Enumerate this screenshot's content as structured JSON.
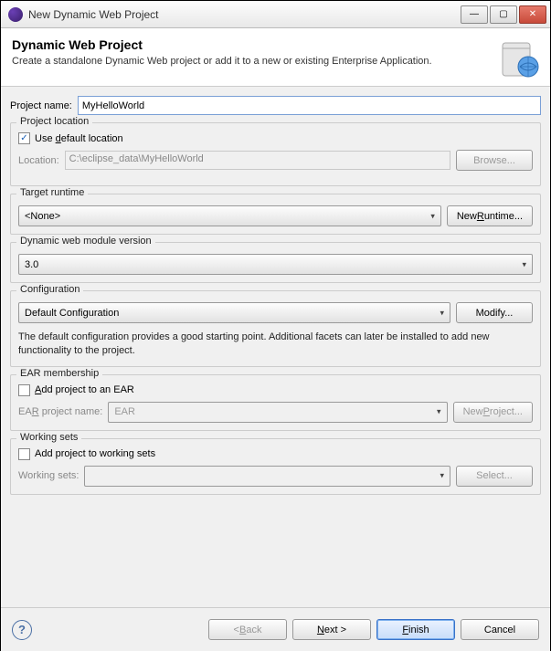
{
  "window": {
    "title": "New Dynamic Web Project"
  },
  "banner": {
    "heading": "Dynamic Web Project",
    "subtitle": "Create a standalone Dynamic Web project or add it to a new or existing Enterprise Application."
  },
  "project_name": {
    "label": "Project name:",
    "value": "MyHelloWorld"
  },
  "project_location": {
    "group_title": "Project location",
    "use_default_checked": true,
    "use_default_label_pre": "Use ",
    "use_default_label_u": "d",
    "use_default_label_post": "efault location",
    "location_label": "Location:",
    "location_value": "C:\\eclipse_data\\MyHelloWorld",
    "browse_label": "Browse..."
  },
  "target_runtime": {
    "group_title": "Target runtime",
    "value": "<None>",
    "new_runtime_pre": "New ",
    "new_runtime_u": "R",
    "new_runtime_post": "untime..."
  },
  "module_version": {
    "group_title": "Dynamic web module version",
    "value": "3.0"
  },
  "configuration": {
    "group_title": "Configuration",
    "value": "Default Configuration",
    "modify_label": "Modify...",
    "description": "The default configuration provides a good starting point. Additional facets can later be installed to add new functionality to the project."
  },
  "ear": {
    "group_title": "EAR membership",
    "add_checked": false,
    "add_label_u": "A",
    "add_label_post": "dd project to an EAR",
    "name_label_pre": "EA",
    "name_label_u": "R",
    "name_label_post": " project name:",
    "value": "EAR",
    "new_project_pre": "New ",
    "new_project_u": "P",
    "new_project_post": "roject..."
  },
  "working_sets": {
    "group_title": "Working sets",
    "add_checked": false,
    "add_label": "Add project to working sets",
    "label": "Working sets:",
    "value": "",
    "select_label": "Select..."
  },
  "footer": {
    "back_pre": "< ",
    "back_u": "B",
    "back_post": "ack",
    "next_u": "N",
    "next_post": "ext >",
    "finish_u": "F",
    "finish_post": "inish",
    "cancel": "Cancel"
  }
}
